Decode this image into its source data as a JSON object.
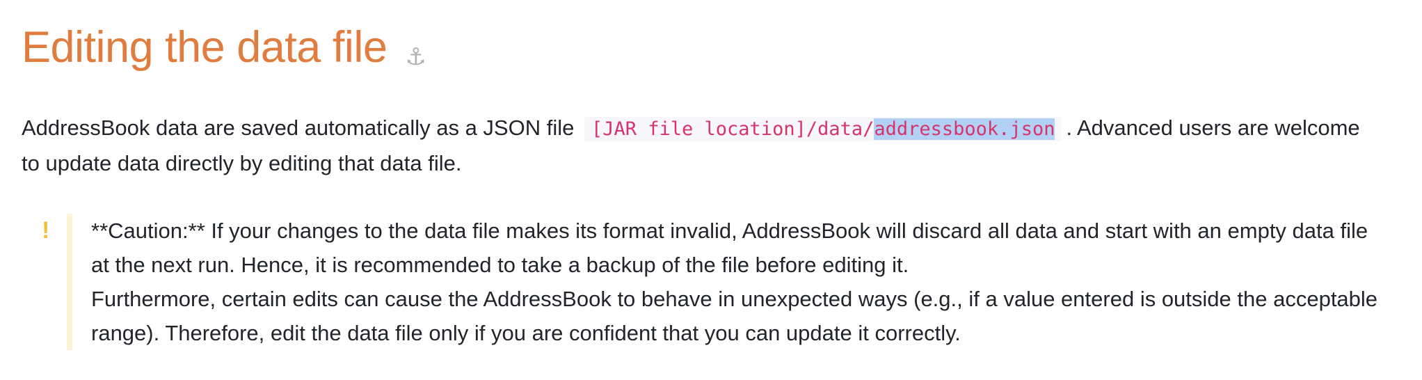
{
  "section": {
    "title": "Editing the data file",
    "anchor_icon": "anchor-icon"
  },
  "intro": {
    "text_before": "AddressBook data are saved automatically as a JSON file",
    "code_prefix": "[JAR file location]/data/",
    "code_selected": "addressbook.json",
    "text_after": ". Advanced users are welcome to update data directly by editing that data file."
  },
  "caution": {
    "icon": "!",
    "icon_color": "#f2c037",
    "line1": "**Caution:** If your changes to the data file makes its format invalid, AddressBook will discard all data and start with an empty data file at the next run. Hence, it is recommended to take a backup of the file before editing it.",
    "line2": "Furthermore, certain edits can cause the AddressBook to behave in unexpected ways (e.g., if a value entered is outside the acceptable range). Therefore, edit the data file only if you are confident that you can update it correctly."
  },
  "colors": {
    "heading": "#e07c3e",
    "code": "#d6336c",
    "selection": "#b3d1f5",
    "callout_border": "#fdf4d6"
  }
}
